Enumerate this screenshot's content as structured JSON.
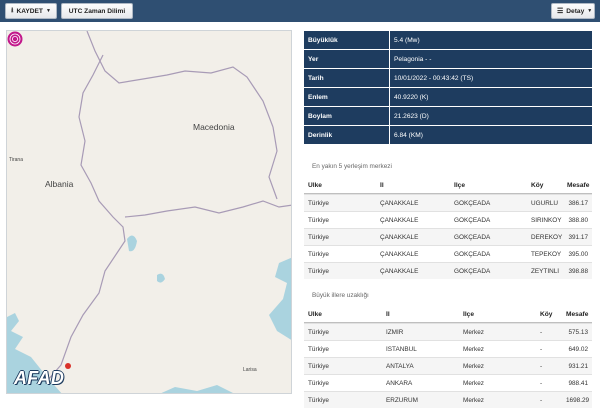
{
  "toolbar": {
    "save_label": "KAYDET",
    "utc_label": "UTC Zaman Dilimi",
    "detail_label": "Detay"
  },
  "map": {
    "labels": {
      "macedonia": "Macedonia",
      "albania": "Albania",
      "tirana": "Tirana",
      "larisa": "Larisa"
    },
    "logo_text": "AFAD",
    "colors": {
      "land": "#f2efe9",
      "water": "#aad3df",
      "border": "#a89bb6",
      "epicenter": "#c2188b"
    }
  },
  "info": [
    {
      "key": "Büyüklük",
      "value": "5.4 (Mw)"
    },
    {
      "key": "Yer",
      "value": "Pelagonia - -"
    },
    {
      "key": "Tarih",
      "value": "10/01/2022 - 00:43:42 (TS)"
    },
    {
      "key": "Enlem",
      "value": "40.9220 (K)"
    },
    {
      "key": "Boylam",
      "value": "21.2623 (D)"
    },
    {
      "key": "Derinlik",
      "value": "6.84 (KM)"
    }
  ],
  "settlements": {
    "title": "En yakın 5 yerleşim merkezi",
    "headers": [
      "Ülke",
      "İl",
      "İlçe",
      "Köy",
      "Mesafe"
    ],
    "rows": [
      [
        "Türkiye",
        "ÇANAKKALE",
        "GÖKÇEADA",
        "UĞURLU",
        "386.17"
      ],
      [
        "Türkiye",
        "ÇANAKKALE",
        "GÖKÇEADA",
        "SIRINKÖY",
        "388.80"
      ],
      [
        "Türkiye",
        "ÇANAKKALE",
        "GÖKÇEADA",
        "DEREKÖY",
        "391.17"
      ],
      [
        "Türkiye",
        "ÇANAKKALE",
        "GÖKÇEADA",
        "TEPEKÖY",
        "395.00"
      ],
      [
        "Türkiye",
        "ÇANAKKALE",
        "GÖKÇEADA",
        "ZEYTİNLİ",
        "398.88"
      ]
    ]
  },
  "cities": {
    "title": "Büyük illere uzaklığı",
    "headers": [
      "Ülke",
      "İl",
      "İlçe",
      "Köy",
      "Mesafe"
    ],
    "rows": [
      [
        "Türkiye",
        "İZMİR",
        "Merkez",
        "-",
        "575.13"
      ],
      [
        "Türkiye",
        "İSTANBUL",
        "Merkez",
        "-",
        "649.02"
      ],
      [
        "Türkiye",
        "ANTALYA",
        "Merkez",
        "-",
        "931.21"
      ],
      [
        "Türkiye",
        "ANKARA",
        "Merkez",
        "-",
        "988.41"
      ],
      [
        "Türkiye",
        "ERZURUM",
        "Merkez",
        "-",
        "1698.29"
      ]
    ]
  }
}
